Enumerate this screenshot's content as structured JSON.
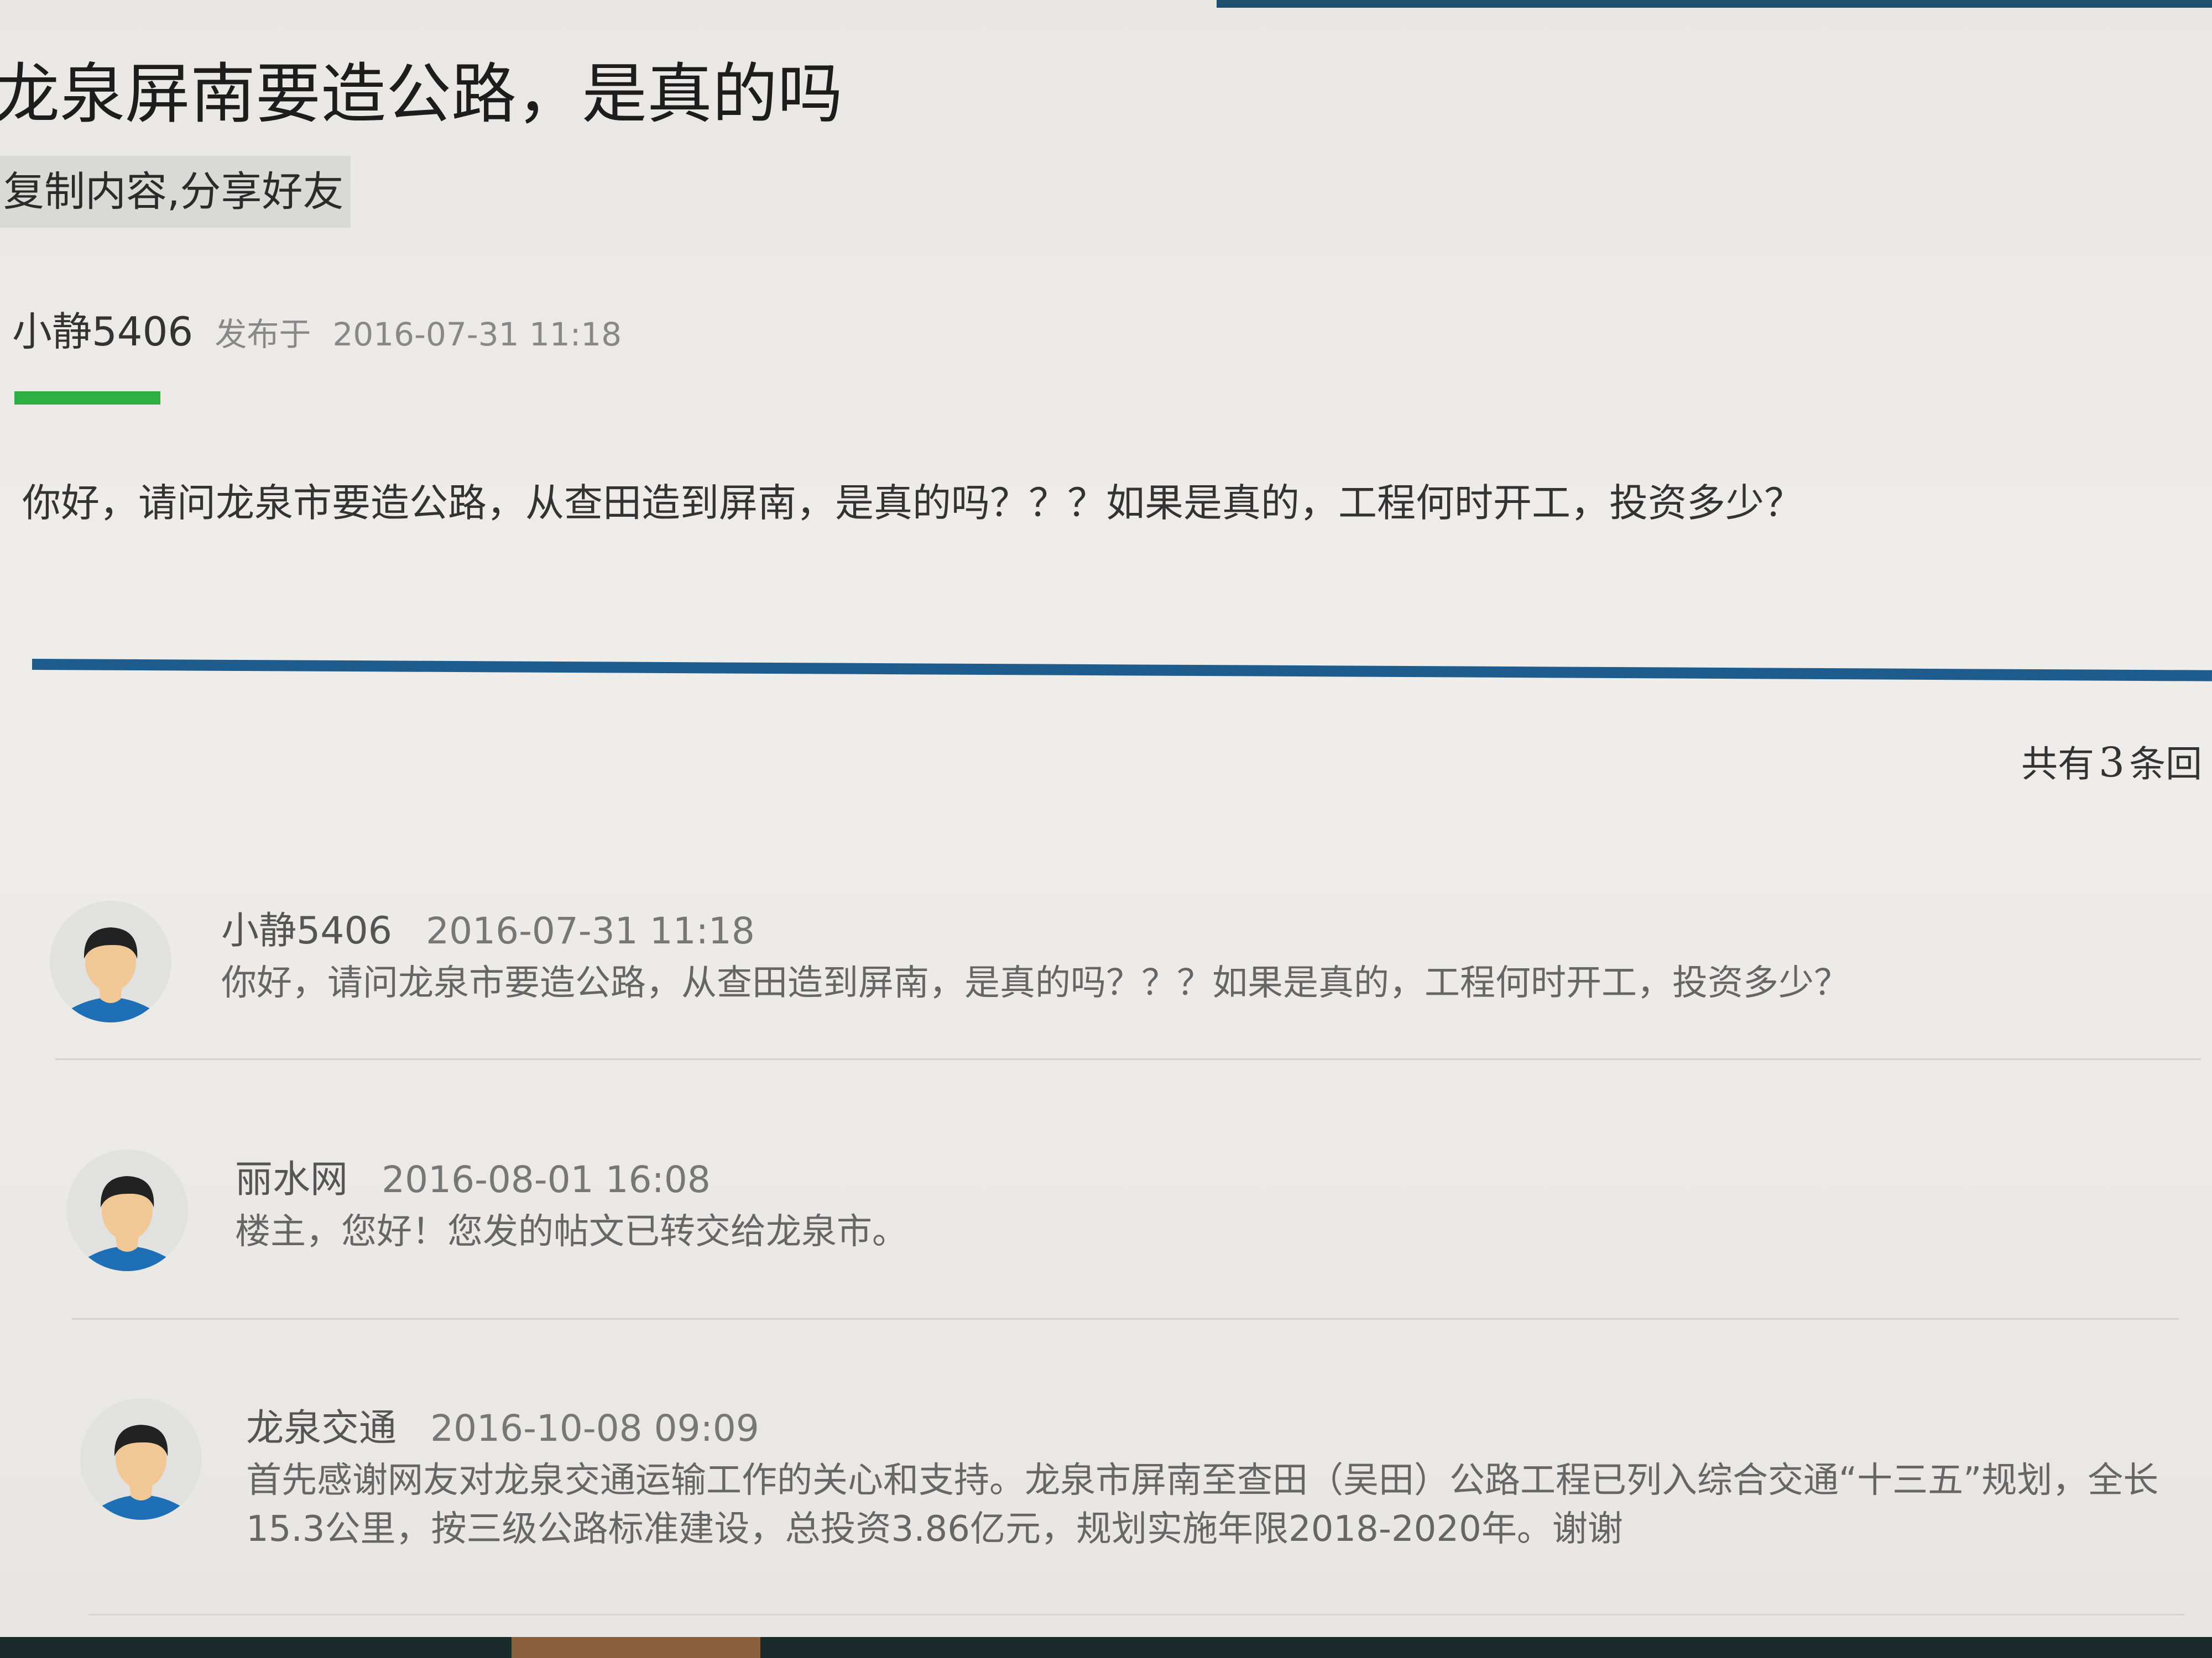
{
  "post": {
    "title": "龙泉屏南要造公路，是真的吗",
    "copy_share_label": "复制内容,分享好友",
    "author": "小静5406",
    "posted_label": "发布于",
    "posted_time": "2016-07-31 11:18",
    "body": "你好，请问龙泉市要造公路，从查田造到屏南，是真的吗？？？如果是真的，工程何时开工，投资多少？"
  },
  "replies_summary": {
    "prefix": "共有",
    "count": "3",
    "suffix": "条回"
  },
  "replies": [
    {
      "author": "小静5406",
      "time": "2016-07-31 11:18",
      "text": "你好，请问龙泉市要造公路，从查田造到屏南，是真的吗？？？如果是真的，工程何时开工，投资多少？"
    },
    {
      "author": "丽水网",
      "time": "2016-08-01 16:08",
      "text": "楼主，您好！您发的帖文已转交给龙泉市。"
    },
    {
      "author": "龙泉交通",
      "time": "2016-10-08 09:09",
      "text": "首先感谢网友对龙泉交通运输工作的关心和支持。龙泉市屏南至查田（吴田）公路工程已列入综合交通“十三五”规划，全长15.3公里，按三级公路标准建设，总投资3.86亿元，规划实施年限2018-2020年。谢谢"
    }
  ],
  "icons": {
    "avatar": "default-user-avatar-icon"
  },
  "colors": {
    "accent_green": "#2fae43",
    "divider_blue": "#1f5c8e",
    "avatar_shirt": "#1e6fb5",
    "avatar_hair": "#222222",
    "avatar_skin": "#f2c796"
  }
}
